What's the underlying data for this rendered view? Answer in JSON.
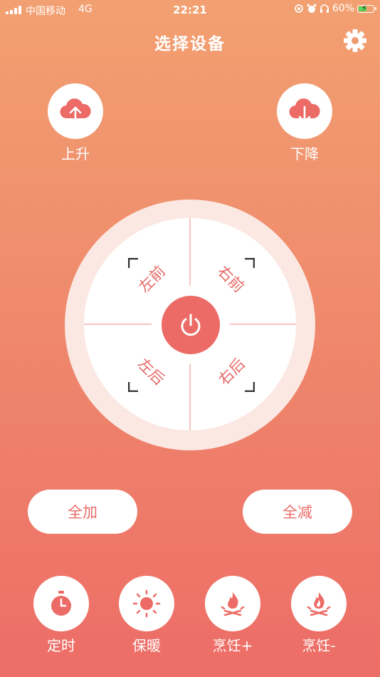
{
  "status_bar": {
    "carrier": "中国移动",
    "network": "4G",
    "time": "22:21",
    "battery": "60%",
    "battery_level": 0.6,
    "icons": [
      "signal-bars-icon",
      "orientation-lock-icon",
      "alarm-clock-icon",
      "headphones-icon",
      "battery-icon"
    ]
  },
  "header": {
    "title": "选择设备",
    "settings_icon": "gear-icon"
  },
  "lift": {
    "up_label": "上升",
    "up_icon": "cloud-upload-icon",
    "down_label": "下降",
    "down_icon": "cloud-download-icon"
  },
  "pad": {
    "front_left": "左前",
    "front_right": "右前",
    "back_left": "左后",
    "back_right": "右后",
    "power_icon": "power-icon"
  },
  "buttons": {
    "all_add": "全加",
    "all_reduce": "全减"
  },
  "bottom": [
    {
      "label": "定时",
      "icon": "stopwatch-icon"
    },
    {
      "label": "保暖",
      "icon": "sun-icon"
    },
    {
      "label": "烹饪+",
      "icon": "campfire-icon"
    },
    {
      "label": "烹饪-",
      "icon": "campfire-icon"
    }
  ],
  "colors": {
    "accent": "#ec6b66",
    "background_top": "#f2a071",
    "background_bottom": "#ed6d67"
  }
}
